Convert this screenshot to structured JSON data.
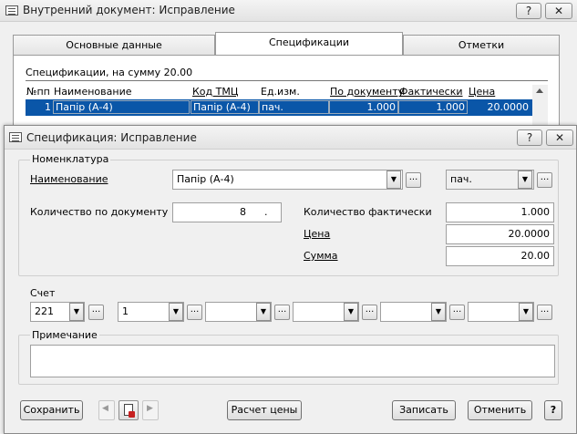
{
  "parent": {
    "title": "Внутренний документ: Исправление",
    "help_btn": "?",
    "close_btn": "✕",
    "tabs": [
      "Основные данные",
      "Спецификации",
      "Отметки"
    ],
    "summary": "Спецификации, на сумму 20.00",
    "columns": [
      "№пп",
      "Наименование",
      "Код ТМЦ",
      "Ед.изм.",
      "По документу",
      "Фактически",
      "Цена"
    ],
    "row": [
      "1",
      "Папір (А-4)",
      "Папір (А-4)",
      "пач.",
      "1.000",
      "1.000",
      "20.0000"
    ]
  },
  "dialog": {
    "title": "Спецификация: Исправление",
    "help_btn": "?",
    "close_btn": "✕",
    "group_title": "Номенклатура",
    "name_label": "Наименование",
    "name_value": "Папір (А-4)",
    "unit_value": "пач.",
    "qty_doc_label": "Количество по документу",
    "qty_doc_value": "8",
    "qty_doc_suffix": ".",
    "qty_fact_label": "Количество фактически",
    "qty_fact_value": "1.000",
    "price_label": "Цена",
    "price_value": "20.0000",
    "sum_label": "Сумма",
    "sum_value": "20.00",
    "account_label": "Счет",
    "accounts": [
      "221",
      "1",
      "",
      "",
      "",
      ""
    ],
    "dots": "...",
    "note_label": "Примечание",
    "note_value": "",
    "buttons": {
      "save": "Сохранить",
      "calc_price": "Расчет цены",
      "record": "Записать",
      "cancel": "Отменить",
      "help": "?"
    },
    "nav_prev": "◀",
    "nav_next": "▶"
  }
}
